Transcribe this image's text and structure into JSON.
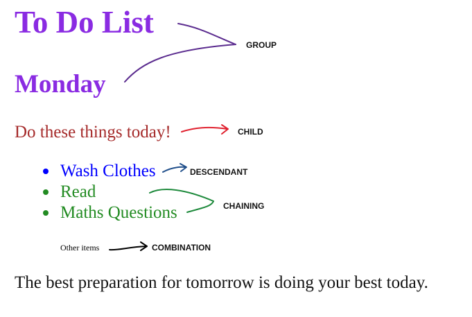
{
  "heading": {
    "title": "To Do List",
    "day": "Monday"
  },
  "intro": "Do these things today!",
  "todo_items": [
    {
      "label": "Wash Clothes",
      "color": "#0000ff"
    },
    {
      "label": "Read",
      "color": "#228b22"
    },
    {
      "label": "Maths Questions",
      "color": "#228b22"
    }
  ],
  "other_items": "Other items",
  "quote": "The best preparation for tomorrow is doing your best today.",
  "annotations": {
    "group": "GROUP",
    "child": "CHILD",
    "descendant": "DESCENDANT",
    "chaining": "CHAINING",
    "combination": "COMBINATION"
  },
  "colors": {
    "heading": "#8a2be2",
    "intro": "#a52a2a",
    "group_arrow": "#5b2c8f",
    "child_arrow": "#e0202e",
    "descendant_arrow": "#1f4e8a",
    "chaining_arrow": "#1e8a3c",
    "combination_arrow": "#000000"
  }
}
